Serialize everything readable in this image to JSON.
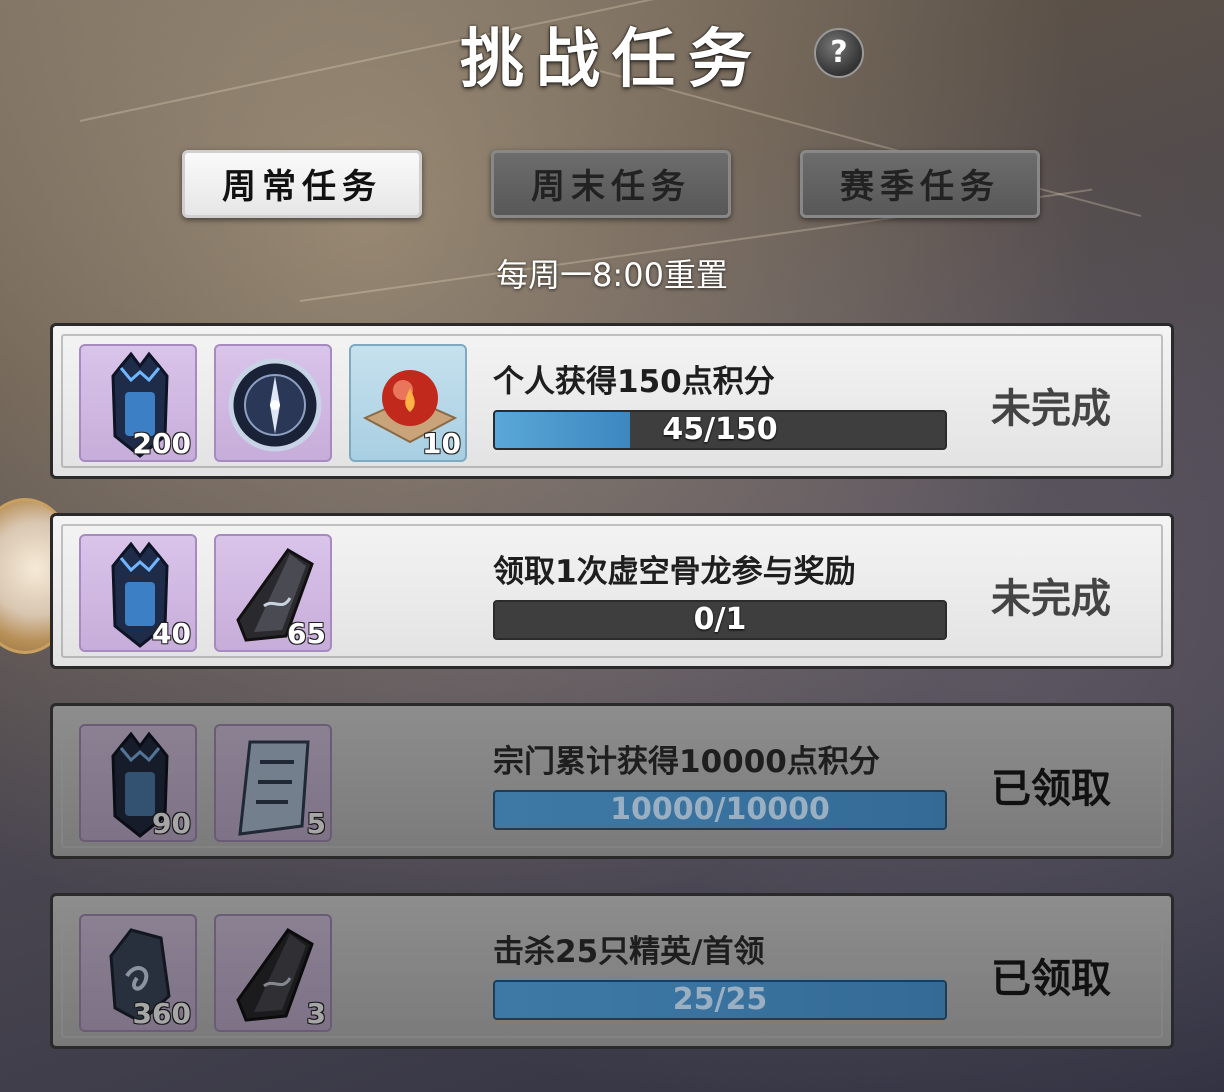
{
  "header": {
    "title": "挑战任务",
    "help_icon": "?"
  },
  "tabs": [
    {
      "label": "周常任务",
      "active": true
    },
    {
      "label": "周末任务",
      "active": false
    },
    {
      "label": "赛季任务",
      "active": false
    }
  ],
  "reset_note": "每周一8:00重置",
  "tasks": [
    {
      "text": "个人获得150点积分",
      "progress_text": "45/150",
      "progress_fraction": 0.3,
      "status": "未完成",
      "claimed": false,
      "rewards": [
        {
          "icon": "demon-shield-icon",
          "count": "200"
        },
        {
          "icon": "compass-disc-icon",
          "count": ""
        },
        {
          "icon": "fire-orb-icon",
          "count": "10",
          "tint": "blue"
        }
      ]
    },
    {
      "text": "领取1次虚空骨龙参与奖励",
      "progress_text": "0/1",
      "progress_fraction": 0,
      "status": "未完成",
      "claimed": false,
      "rewards": [
        {
          "icon": "demon-shield-icon",
          "count": "40"
        },
        {
          "icon": "dark-stone-icon",
          "count": "65"
        }
      ]
    },
    {
      "text": "宗门累计获得10000点积分",
      "progress_text": "10000/10000",
      "progress_fraction": 1,
      "status": "已领取",
      "claimed": true,
      "rewards": [
        {
          "icon": "demon-shield-icon",
          "count": "90"
        },
        {
          "icon": "scroll-banner-icon",
          "count": "5"
        }
      ]
    },
    {
      "text": "击杀25只精英/首领",
      "progress_text": "25/25",
      "progress_fraction": 1,
      "status": "已领取",
      "claimed": true,
      "rewards": [
        {
          "icon": "spirit-crystal-icon",
          "count": "360"
        },
        {
          "icon": "dark-stone-icon",
          "count": "3"
        }
      ]
    }
  ]
}
